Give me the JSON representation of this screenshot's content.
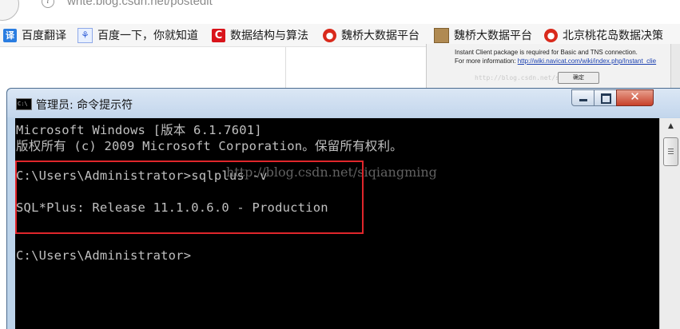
{
  "browser": {
    "url": "write.blog.csdn.net/postedit",
    "back_glyph": "←",
    "info_glyph": "i"
  },
  "bookmarks": [
    {
      "label": "百度翻译",
      "icon": "translate-icon",
      "glyph": "译"
    },
    {
      "label": "百度一下，你就知道",
      "icon": "baidu-paw-icon",
      "glyph": "⚘"
    },
    {
      "label": "数据结构与算法",
      "icon": "csdn-c-icon",
      "glyph": "C"
    },
    {
      "label": "魏桥大数据平台",
      "icon": "red-swirl-icon",
      "glyph": "●"
    },
    {
      "label": "魏桥大数据平台",
      "icon": "image-thumb-icon",
      "glyph": ""
    },
    {
      "label": "北京桃花岛数据决策",
      "icon": "red-swirl-icon",
      "glyph": "●"
    }
  ],
  "background_dialog": {
    "line1": "Instant Client package is required for Basic and TNS connection.",
    "line2_prefix": "For more information: ",
    "line2_link": "http://wiki.navicat.com/wiki/index.php/Instant_clie",
    "ok_button": "确定"
  },
  "console_window": {
    "title": "管理员: 命令提示符",
    "icon_text": "C:\\",
    "close_glyph": "✕",
    "lines": [
      "Microsoft Windows [版本 6.1.7601]",
      "版权所有 (c) 2009 Microsoft Corporation。保留所有权利。",
      "",
      "C:\\Users\\Administrator>sqlplus -v",
      "",
      "SQL*Plus: Release 11.1.0.6.0 - Production",
      "",
      "",
      "C:\\Users\\Administrator>"
    ],
    "watermark": "http://blog.csdn.net/siqiangming",
    "scroll_up_glyph": "▲"
  },
  "colors": {
    "highlight_box": "#e0262b",
    "console_bg": "#000000",
    "console_text": "#c0c0c0"
  }
}
